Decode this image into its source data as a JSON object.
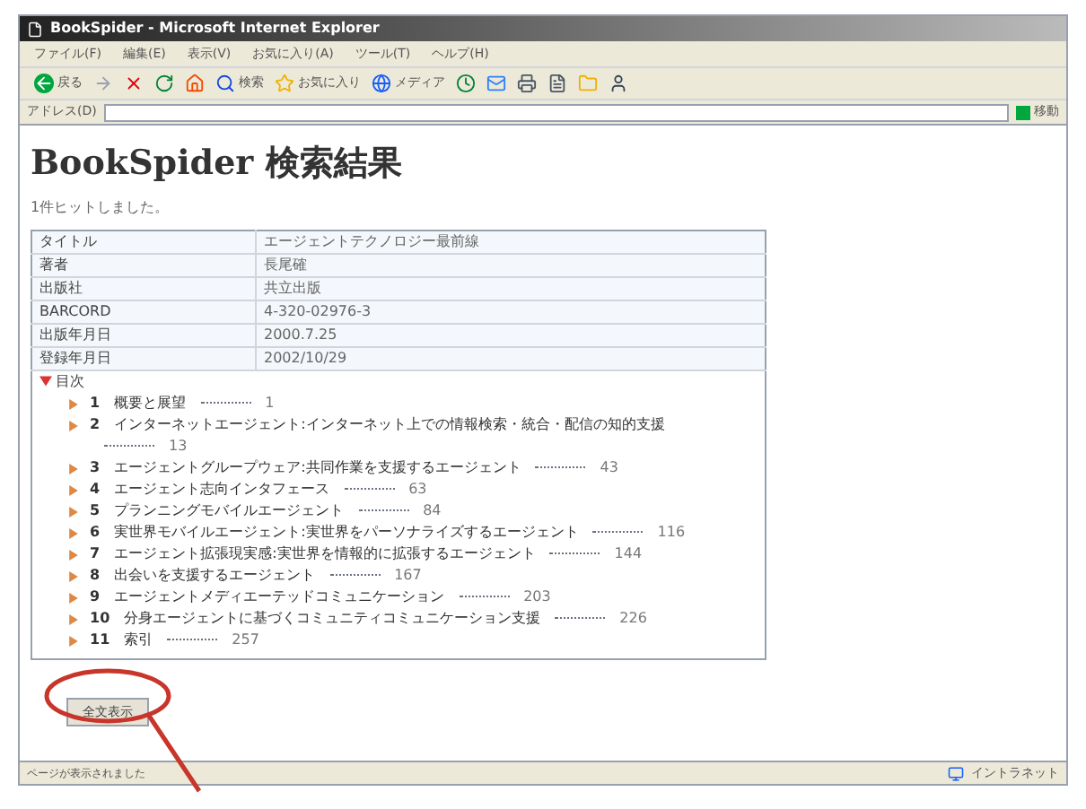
{
  "window": {
    "title": "BookSpider - Microsoft Internet Explorer"
  },
  "menu": [
    "ファイル(F)",
    "編集(E)",
    "表示(V)",
    "お気に入り(A)",
    "ツール(T)",
    "ヘルプ(H)"
  ],
  "toolbar": [
    {
      "kind": "back",
      "label": "戻る"
    },
    {
      "kind": "forward"
    },
    {
      "kind": "stop"
    },
    {
      "kind": "refresh"
    },
    {
      "kind": "home"
    },
    {
      "kind": "search",
      "label": "検索"
    },
    {
      "kind": "favorites",
      "label": "お気に入り"
    },
    {
      "kind": "media",
      "label": "メディア"
    },
    {
      "kind": "history"
    },
    {
      "kind": "mail"
    },
    {
      "kind": "print"
    },
    {
      "kind": "edit"
    },
    {
      "kind": "folder"
    },
    {
      "kind": "messenger"
    }
  ],
  "address": {
    "label": "アドレス(D)",
    "go": "移動"
  },
  "page": {
    "heading": "BookSpider 検索結果",
    "hits": "1件ヒットしました。",
    "details": [
      {
        "label": "タイトル",
        "value": "エージェントテクノロジー最前線"
      },
      {
        "label": "著者",
        "value": "長尾確"
      },
      {
        "label": "出版社",
        "value": "共立出版"
      },
      {
        "label": "BARCORD",
        "value": "4-320-02976-3"
      },
      {
        "label": "出版年月日",
        "value": "2000.7.25"
      },
      {
        "label": "登録年月日",
        "value": "2002/10/29"
      }
    ],
    "toc": {
      "title": "目次",
      "expanded": true,
      "items": [
        {
          "number": "1",
          "title": "概要と展望",
          "page": "1"
        },
        {
          "number": "2",
          "title": "インターネットエージェント:インターネット上での情報検索・統合・配信の知的支援",
          "page": "13"
        },
        {
          "number": "3",
          "title": "エージェントグループウェア:共同作業を支援するエージェント",
          "page": "43"
        },
        {
          "number": "4",
          "title": "エージェント志向インタフェース",
          "page": "63"
        },
        {
          "number": "5",
          "title": "プランニングモバイルエージェント",
          "page": "84"
        },
        {
          "number": "6",
          "title": "実世界モバイルエージェント:実世界をパーソナライズするエージェント",
          "page": "116"
        },
        {
          "number": "7",
          "title": "エージェント拡張現実感:実世界を情報的に拡張するエージェント",
          "page": "144"
        },
        {
          "number": "8",
          "title": "出会いを支援するエージェント",
          "page": "167"
        },
        {
          "number": "9",
          "title": "エージェントメディエーテッドコミュニケーション",
          "page": "203"
        },
        {
          "number": "10",
          "title": "分身エージェントに基づくコミュニティコミュニケーション支援",
          "page": "226"
        },
        {
          "number": "11",
          "title": "索引",
          "page": "257"
        }
      ]
    },
    "button": "全文表示"
  },
  "status_bar": {
    "text": "ページが表示されました",
    "zone": "イントラネット"
  }
}
